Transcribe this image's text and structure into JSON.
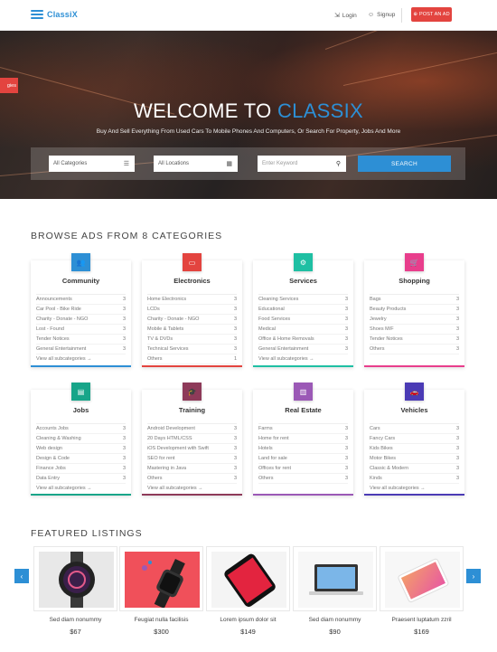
{
  "header": {
    "logo": "ClassiX",
    "login": "Login",
    "signup": "Signup",
    "post_ad": "POST AN AD"
  },
  "hero": {
    "side_tab": "gies",
    "title_main": "WELCOME TO ",
    "title_accent": "CLASSIX",
    "subtitle": "Buy And Sell Everything From Used Cars To Mobile Phones And Computers, Or Search For Property, Jobs And More",
    "category_select": "All Categories",
    "location_select": "All Locations",
    "keyword_placeholder": "Enter Keyword",
    "search_button": "SEARCH"
  },
  "categories_title": "BROWSE ADS FROM 8 CATEGORIES",
  "categories": [
    {
      "title": "Community",
      "color": "#2d8fd5",
      "icon": "users-icon",
      "line": "#2d8fd5",
      "items": [
        [
          "Announcements",
          "3"
        ],
        [
          "Car Pool - Bike Ride",
          "3"
        ],
        [
          "Charity - Donate - NGO",
          "3"
        ],
        [
          "Lost - Found",
          "3"
        ],
        [
          "Tender Notices",
          "3"
        ],
        [
          "General Entertainment",
          "3"
        ]
      ],
      "view_all": "View all subcategories →"
    },
    {
      "title": "Electronics",
      "color": "#e3443f",
      "icon": "laptop-icon",
      "line": "#e3443f",
      "items": [
        [
          "Home Electronics",
          "3"
        ],
        [
          "LCDs",
          "3"
        ],
        [
          "Charity - Donate - NGO",
          "3"
        ],
        [
          "Mobile & Tablets",
          "3"
        ],
        [
          "TV & DVDs",
          "3"
        ],
        [
          "Technical Services",
          "3"
        ],
        [
          "Others",
          "1"
        ]
      ],
      "view_all": ""
    },
    {
      "title": "Services",
      "color": "#1fbfa3",
      "icon": "gear-icon",
      "line": "#1fbfa3",
      "items": [
        [
          "Cleaning Services",
          "3"
        ],
        [
          "Educational",
          "3"
        ],
        [
          "Food Services",
          "3"
        ],
        [
          "Medical",
          "3"
        ],
        [
          "Office & Home Removals",
          "3"
        ],
        [
          "General Entertainment",
          "3"
        ]
      ],
      "view_all": "View all subcategories →"
    },
    {
      "title": "Shopping",
      "color": "#e83e8c",
      "icon": "cart-icon",
      "line": "#e83e8c",
      "items": [
        [
          "Bags",
          "3"
        ],
        [
          "Beauty Products",
          "3"
        ],
        [
          "Jewelry",
          "3"
        ],
        [
          "Shoes M/F",
          "3"
        ],
        [
          "Tender Notices",
          "3"
        ],
        [
          "Others",
          "3"
        ]
      ],
      "view_all": ""
    },
    {
      "title": "Jobs",
      "color": "#17a589",
      "icon": "briefcase-icon",
      "line": "#17a589",
      "items": [
        [
          "Accounts Jobs",
          "3"
        ],
        [
          "Cleaning & Washing",
          "3"
        ],
        [
          "Web design",
          "3"
        ],
        [
          "Design & Code",
          "3"
        ],
        [
          "Finance Jobs",
          "3"
        ],
        [
          "Data Entry",
          "3"
        ]
      ],
      "view_all": "View all subcategories →"
    },
    {
      "title": "Training",
      "color": "#8e3a59",
      "icon": "graduation-icon",
      "line": "#8e3a59",
      "items": [
        [
          "Android Development",
          "3"
        ],
        [
          "20 Days HTML/CSS",
          "3"
        ],
        [
          "iOS Development with Swift",
          "3"
        ],
        [
          "SEO for rent",
          "3"
        ],
        [
          "Mastering in Java",
          "3"
        ],
        [
          "Others",
          "3"
        ]
      ],
      "view_all": "View all subcategories →"
    },
    {
      "title": "Real Estate",
      "color": "#9b59b6",
      "icon": "building-icon",
      "line": "#9b59b6",
      "items": [
        [
          "Farms",
          "3"
        ],
        [
          "Home for rent",
          "3"
        ],
        [
          "Hotels",
          "3"
        ],
        [
          "Land for sale",
          "3"
        ],
        [
          "Offices for rent",
          "3"
        ],
        [
          "Others",
          "3"
        ]
      ],
      "view_all": ""
    },
    {
      "title": "Vehicles",
      "color": "#4b3bb5",
      "icon": "car-icon",
      "line": "#4b3bb5",
      "items": [
        [
          "Cars",
          "3"
        ],
        [
          "Fancy Cars",
          "3"
        ],
        [
          "Kids Bikes",
          "3"
        ],
        [
          "Motor Bikes",
          "3"
        ],
        [
          "Classic & Modern",
          "3"
        ],
        [
          "Kinds",
          "3"
        ]
      ],
      "view_all": "View all subcategories →"
    }
  ],
  "featured_title": "FEATURED LISTINGS",
  "featured": [
    {
      "name": "Sed diam nonummy",
      "price": "$67",
      "icon": "smartwatch-icon"
    },
    {
      "name": "Feugiat nulla facilisis",
      "price": "$300",
      "icon": "watch-icon"
    },
    {
      "name": "Lorem ipsum dolor sit",
      "price": "$149",
      "icon": "phone-icon"
    },
    {
      "name": "Sed diam nonummy",
      "price": "$90",
      "icon": "laptop-icon"
    },
    {
      "name": "Praesent luptatum zzril",
      "price": "$169",
      "icon": "tablet-icon"
    }
  ]
}
